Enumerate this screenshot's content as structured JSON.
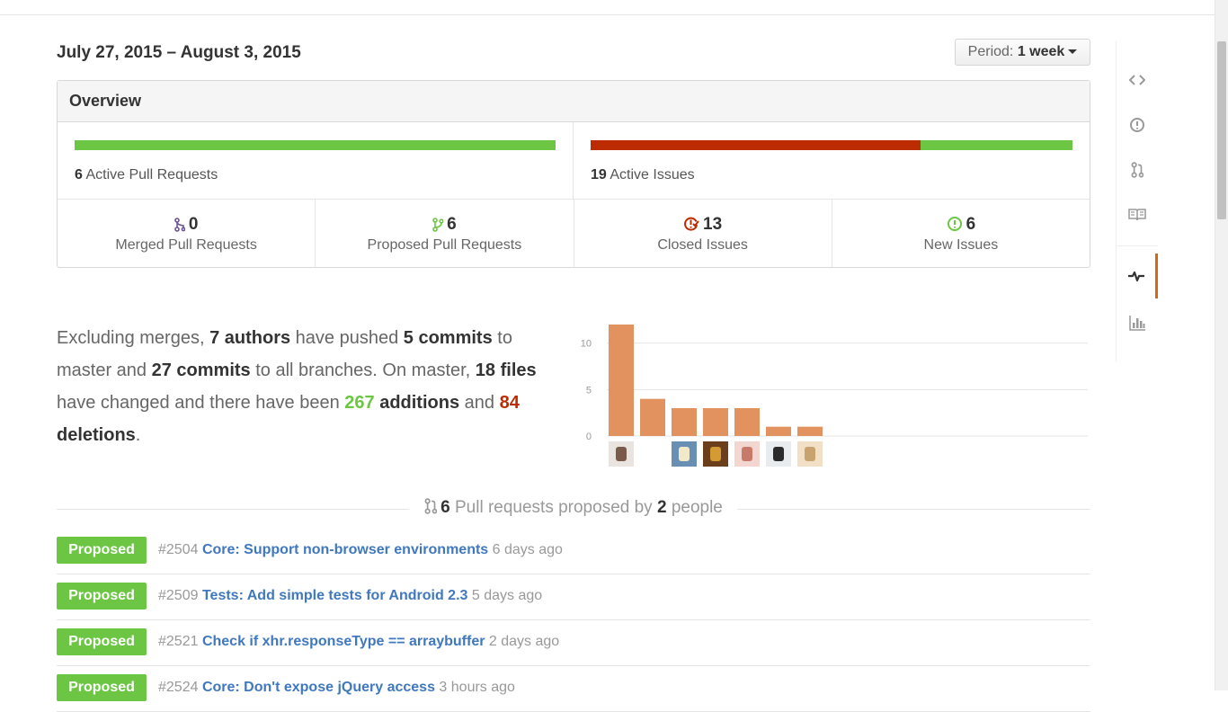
{
  "header": {
    "date_range": "July 27, 2015 – August 3, 2015",
    "period_label": "Period:",
    "period_value": "1 week"
  },
  "overview": {
    "title": "Overview",
    "active_prs_count": "6",
    "active_prs_label": "Active Pull Requests",
    "active_prs_bar": {
      "merged_fraction": 0.0,
      "proposed_fraction": 1.0
    },
    "active_issues_count": "19",
    "active_issues_label": "Active Issues",
    "active_issues_bar": {
      "closed_fraction": 0.684,
      "new_fraction": 0.316
    },
    "stats": [
      {
        "icon": "git-merge-icon",
        "value": "0",
        "label": "Merged Pull Requests",
        "color": "#6e5494"
      },
      {
        "icon": "git-pull-request-icon",
        "value": "6",
        "label": "Proposed Pull Requests",
        "color": "#6cc644"
      },
      {
        "icon": "issue-closed-icon",
        "value": "13",
        "label": "Closed Issues",
        "color": "#bd2c00"
      },
      {
        "icon": "issue-opened-icon",
        "value": "6",
        "label": "New Issues",
        "color": "#6cc644"
      }
    ]
  },
  "summary": {
    "t1": "Excluding merges, ",
    "authors": "7 authors",
    "t2": " have pushed ",
    "commits_master": "5 commits",
    "t3": " to master and ",
    "commits_all": "27 commits",
    "t4": " to all branches. On master, ",
    "files": "18 files",
    "t5": " have changed and there have been ",
    "additions_num": "267",
    "additions_word": " additions",
    "t6": " and ",
    "deletions_num": "84",
    "deletions_word": "deletions",
    "t7": "."
  },
  "chart_data": {
    "type": "bar",
    "categories": [
      "author 1",
      "author 2",
      "author 3",
      "author 4",
      "author 5",
      "author 6",
      "author 7"
    ],
    "values": [
      12,
      4,
      3,
      3,
      3,
      1,
      1
    ],
    "ylim": [
      0,
      12
    ],
    "yticks": [
      "0",
      "5",
      "10"
    ],
    "bar_color": "#e1925f",
    "grid": true,
    "title": "",
    "xlabel": "",
    "ylabel": ""
  },
  "pr_section": {
    "count": "6",
    "t1": "Pull requests proposed by",
    "people_count": "2",
    "t2": "people"
  },
  "pull_requests": [
    {
      "badge": "Proposed",
      "number": "#2504",
      "title": "Core: Support non-browser environments",
      "time": "6 days ago"
    },
    {
      "badge": "Proposed",
      "number": "#2509",
      "title": "Tests: Add simple tests for Android 2.3",
      "time": "5 days ago"
    },
    {
      "badge": "Proposed",
      "number": "#2521",
      "title": "Check if xhr.responseType == arraybuffer",
      "time": "2 days ago"
    },
    {
      "badge": "Proposed",
      "number": "#2524",
      "title": "Core: Don't expose jQuery access",
      "time": "3 hours ago"
    }
  ],
  "sidenav": [
    {
      "icon": "code-icon"
    },
    {
      "icon": "issue-opened-icon"
    },
    {
      "icon": "git-pull-request-icon"
    },
    {
      "icon": "book-icon"
    },
    {
      "icon": "pulse-icon",
      "selected": true
    },
    {
      "icon": "graph-icon"
    }
  ],
  "colors": {
    "green": "#6cc644",
    "red": "#bd2c00",
    "link": "#4078c0",
    "accent": "#d26911"
  }
}
